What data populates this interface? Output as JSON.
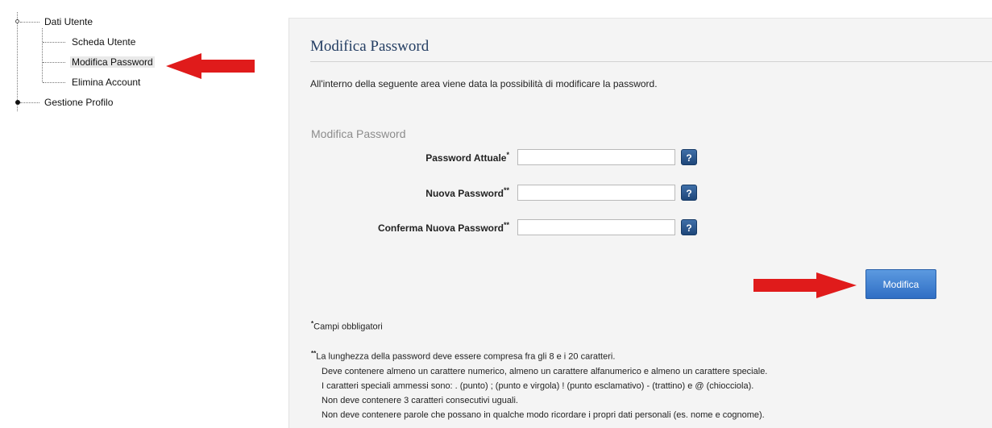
{
  "sidebar": {
    "root_user": "Dati Utente",
    "items": [
      {
        "label": "Scheda Utente"
      },
      {
        "label": "Modifica Password"
      },
      {
        "label": "Elimina Account"
      }
    ],
    "root_profile": "Gestione Profilo"
  },
  "main": {
    "title": "Modifica Password",
    "intro": "All'interno della seguente area viene data la possibilità di modificare la password.",
    "section_title": "Modifica Password",
    "fields": [
      {
        "label": "Password Attuale",
        "mark": "*",
        "value": ""
      },
      {
        "label": "Nuova Password",
        "mark": "**",
        "value": ""
      },
      {
        "label": "Conferma Nuova Password",
        "mark": "**",
        "value": ""
      }
    ],
    "help_label": "?",
    "submit_label": "Modifica",
    "required_mark": "*",
    "required_note": "Campi obbligatori",
    "rules_mark": "**",
    "rules": [
      "La lunghezza della password deve essere compresa fra gli 8 e i 20 caratteri.",
      "Deve contenere almeno un carattere numerico, almeno un carattere alfanumerico e almeno un carattere speciale.",
      "I caratteri speciali ammessi sono: . (punto) ; (punto e virgola) ! (punto esclamativo) - (trattino) e @ (chiocciola).",
      "Non deve contenere 3 caratteri consecutivi uguali.",
      "Non deve contenere parole che possano in qualche modo ricordare i propri dati personali (es. nome e cognome)."
    ]
  },
  "colors": {
    "title": "#243e63",
    "button": "#2f6ec4",
    "arrow": "#e01b1b",
    "panel_bg": "#f4f4f4"
  },
  "icons": {
    "arrow_left": "red-arrow-left-icon",
    "arrow_right": "red-arrow-right-icon",
    "help": "help-question-icon"
  }
}
